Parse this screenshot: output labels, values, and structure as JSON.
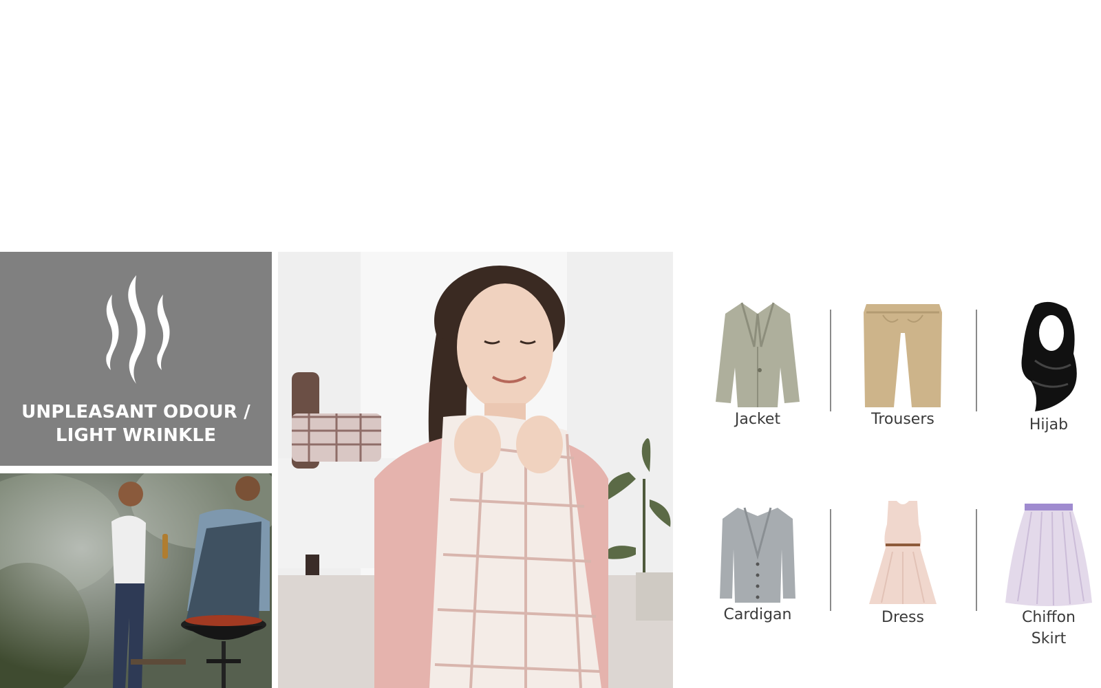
{
  "feature_panel": {
    "icon": "steam-waves-icon",
    "title_line1": "UNPLEASANT  ODOUR /",
    "title_line2": "LIGHT WRINKLE",
    "background_color": "#808080"
  },
  "photos": {
    "bbq": "people-barbecue-photo",
    "woman": "woman-smelling-fresh-shirt-photo"
  },
  "garments": [
    {
      "icon": "jacket-icon",
      "label": "Jacket"
    },
    {
      "icon": "trousers-icon",
      "label": "Trousers"
    },
    {
      "icon": "hijab-icon",
      "label": "Hijab"
    },
    {
      "icon": "cardigan-icon",
      "label": "Cardigan"
    },
    {
      "icon": "dress-icon",
      "label": "Dress"
    },
    {
      "icon": "chiffon-skirt-icon",
      "label": "Chiffon\nSkirt"
    }
  ]
}
